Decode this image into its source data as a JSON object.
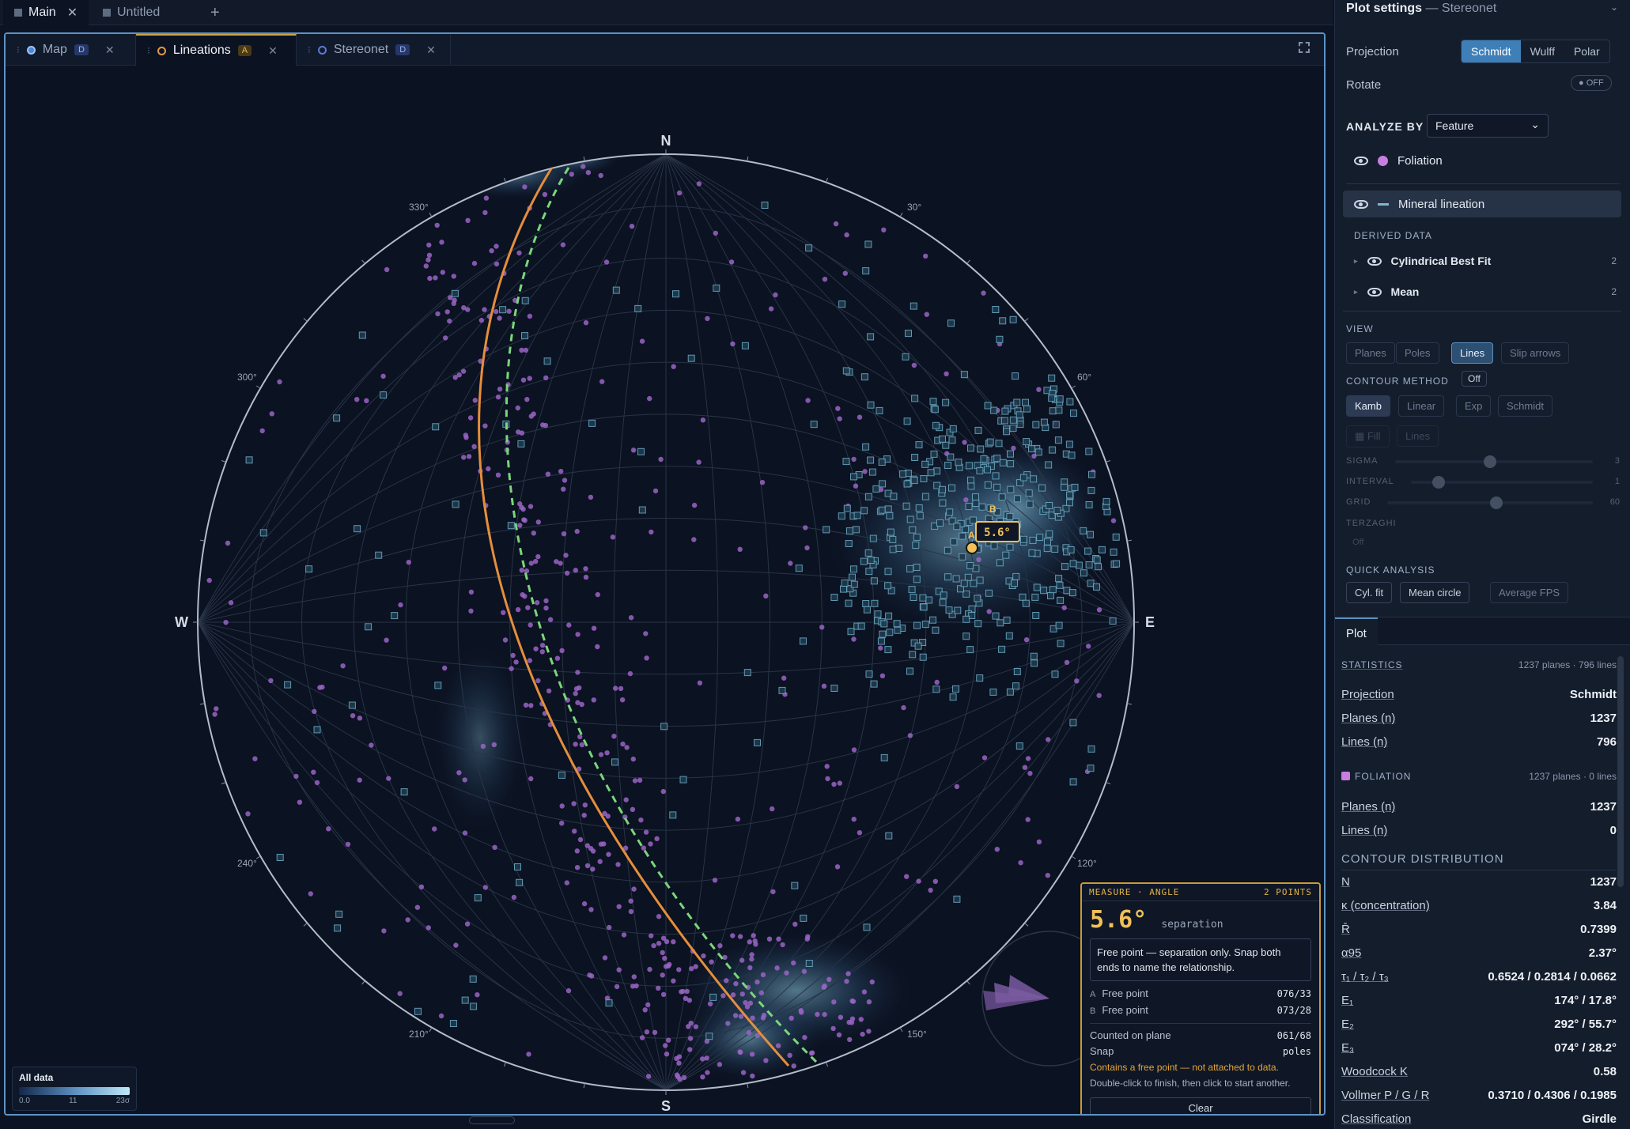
{
  "topbar": {
    "tabs": [
      {
        "label": "Main"
      },
      {
        "label": "Untitled"
      }
    ],
    "add_label": "+"
  },
  "workspace": {
    "tabs": [
      {
        "label": "Map",
        "badge": "D"
      },
      {
        "label": "Lineations",
        "badge": "A"
      },
      {
        "label": "Stereonet",
        "badge": "D"
      }
    ],
    "maximize_icon": "expand-icon"
  },
  "stereonet": {
    "cardinals": {
      "n": "N",
      "e": "E",
      "s": "S",
      "w": "W"
    },
    "azimuth_labels": [
      "30°",
      "60°",
      "120°",
      "150°",
      "210°",
      "240°",
      "300°",
      "330°"
    ],
    "angle_tag": "5.6°",
    "point_a": "A",
    "point_b": "B",
    "legend": {
      "title": "All data",
      "min": "0.0",
      "mid": "11",
      "max": "23σ"
    }
  },
  "measure": {
    "title": "MEASURE · ANGLE",
    "count": "2 POINTS",
    "value": "5.6°",
    "value_caption": "separation",
    "note": "Free point — separation only. Snap both ends to name the relationship.",
    "points": [
      {
        "key": "A",
        "label": "Free point",
        "value": "076/33"
      },
      {
        "key": "B",
        "label": "Free point",
        "value": "073/28"
      }
    ],
    "plane_label": "Counted on plane",
    "plane_value": "061/68",
    "snap_label": "Snap",
    "snap_value": "poles",
    "warning": "Contains a free point — not attached to data.",
    "hint": "Double-click to finish, then click to start another.",
    "clear_label": "Clear"
  },
  "panel": {
    "title": "Plot settings",
    "subtitle": "— Stereonet",
    "projection_label": "Projection",
    "projection_options": [
      "Schmidt",
      "Wulff",
      "Polar"
    ],
    "projection_selected": "Schmidt",
    "rotate_label": "Rotate",
    "rotate_state": "OFF",
    "analyze_label": "ANALYZE BY",
    "analyze_value": "Feature",
    "layers": [
      {
        "label": "Foliation",
        "color": "#c77ee0"
      },
      {
        "label": "Mineral lineation",
        "color": "#7fb6c9"
      }
    ],
    "derived_label": "DERIVED DATA",
    "derived": [
      {
        "label": "Cylindrical Best Fit",
        "count": "2"
      },
      {
        "label": "Mean",
        "count": "2"
      }
    ],
    "view_label": "VIEW",
    "view_options": [
      "Planes",
      "Poles",
      "Lines",
      "Slip arrows"
    ],
    "view_selected": "Lines",
    "contour_label": "CONTOUR METHOD",
    "contour_state": "Off",
    "contour_methods": [
      "Kamb",
      "Linear",
      "Exp",
      "Schmidt"
    ],
    "contour_modes": [
      "Fill",
      "Lines"
    ],
    "sliders": [
      {
        "label": "SIGMA",
        "value": "3",
        "level": 0.48
      },
      {
        "label": "INTERVAL",
        "value": "1",
        "level": 0.15
      },
      {
        "label": "GRID",
        "value": "60",
        "level": 0.53
      }
    ],
    "terzaghi_label": "TERZAGHI",
    "terzaghi_value": "Off",
    "quick_label": "QUICK ANALYSIS",
    "quick_actions": [
      "Cyl. fit",
      "Mean circle",
      "Average FPS"
    ],
    "plot_tab": "Plot",
    "stats": {
      "title": "STATISTICS",
      "summary": "1237 planes · 796 lines",
      "rows": [
        {
          "label": "Projection",
          "value": "Schmidt"
        },
        {
          "label": "Planes (n)",
          "value": "1237"
        },
        {
          "label": "Lines (n)",
          "value": "796"
        }
      ],
      "foliation_title": "FOLIATION",
      "foliation_summary": "1237 planes · 0 lines",
      "foliation_rows": [
        {
          "label": "Planes (n)",
          "value": "1237"
        },
        {
          "label": "Lines (n)",
          "value": "0"
        }
      ],
      "contour_title": "CONTOUR DISTRIBUTION",
      "contour_rows": [
        {
          "label": "N",
          "value": "1237"
        },
        {
          "label": "κ (concentration)",
          "value": "3.84"
        },
        {
          "label": "R̄",
          "value": "0.7399"
        },
        {
          "label": "α95",
          "value": "2.37°"
        },
        {
          "label": "τ₁ / τ₂ / τ₃",
          "value": "0.6524 / 0.2814 / 0.0662"
        },
        {
          "label": "E₁",
          "value": "174° / 17.8°"
        },
        {
          "label": "E₂",
          "value": "292° / 55.7°"
        },
        {
          "label": "E₃",
          "value": "074° / 28.2°"
        },
        {
          "label": "Woodcock K",
          "value": "0.58"
        },
        {
          "label": "Vollmer P / G / R",
          "value": "0.3710 / 0.4306 / 0.1985"
        },
        {
          "label": "Classification",
          "value": "Girdle"
        }
      ]
    }
  }
}
